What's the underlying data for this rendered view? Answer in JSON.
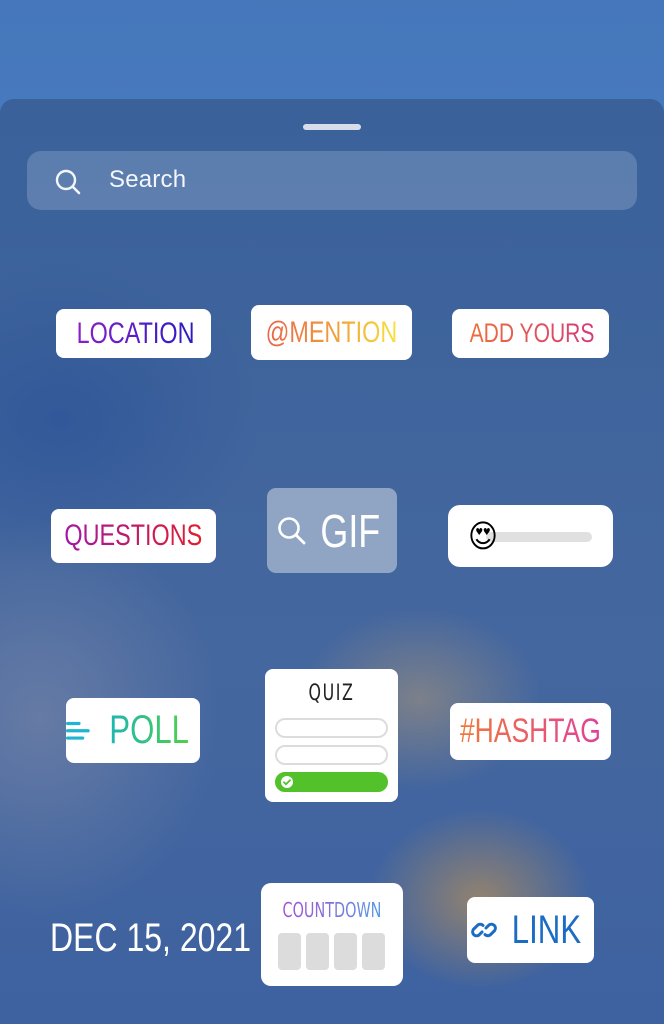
{
  "sheet": {
    "search": {
      "placeholder": "Search",
      "icon": "search-icon"
    }
  },
  "stickers": {
    "location": {
      "label": "LOCATION",
      "icon": "location-pin-icon",
      "colors": [
        "#8a1fc8",
        "#2b1bc2"
      ]
    },
    "mention": {
      "label": "@MENTION",
      "colors": [
        "#e9624a",
        "#f7e33c"
      ]
    },
    "add_yours": {
      "label": "ADD YOURS",
      "icon": "camera-icon",
      "colors": [
        "#ef6f3a",
        "#d53a7a"
      ]
    },
    "questions": {
      "label": "QUESTIONS",
      "colors": [
        "#a117a6",
        "#e11f2a"
      ]
    },
    "gif": {
      "label": "GIF",
      "icon": "search-icon"
    },
    "emoji_slider": {
      "emoji": "😍",
      "value": 0
    },
    "poll": {
      "label": "POLL",
      "icon": "poll-lines-icon",
      "colors": [
        "#1fb5b3",
        "#4fd04a"
      ]
    },
    "quiz": {
      "label": "QUIZ",
      "options": 3,
      "correct_option": 3
    },
    "hashtag": {
      "label": "#HASHTAG",
      "colors": [
        "#f07a3a",
        "#e0409a"
      ]
    },
    "date": {
      "label": "DEC 15, 2021"
    },
    "countdown": {
      "label": "COUNTDOWN",
      "boxes": 4
    },
    "link": {
      "label": "LINK",
      "icon": "link-icon",
      "color": "#1b6cc4"
    }
  }
}
